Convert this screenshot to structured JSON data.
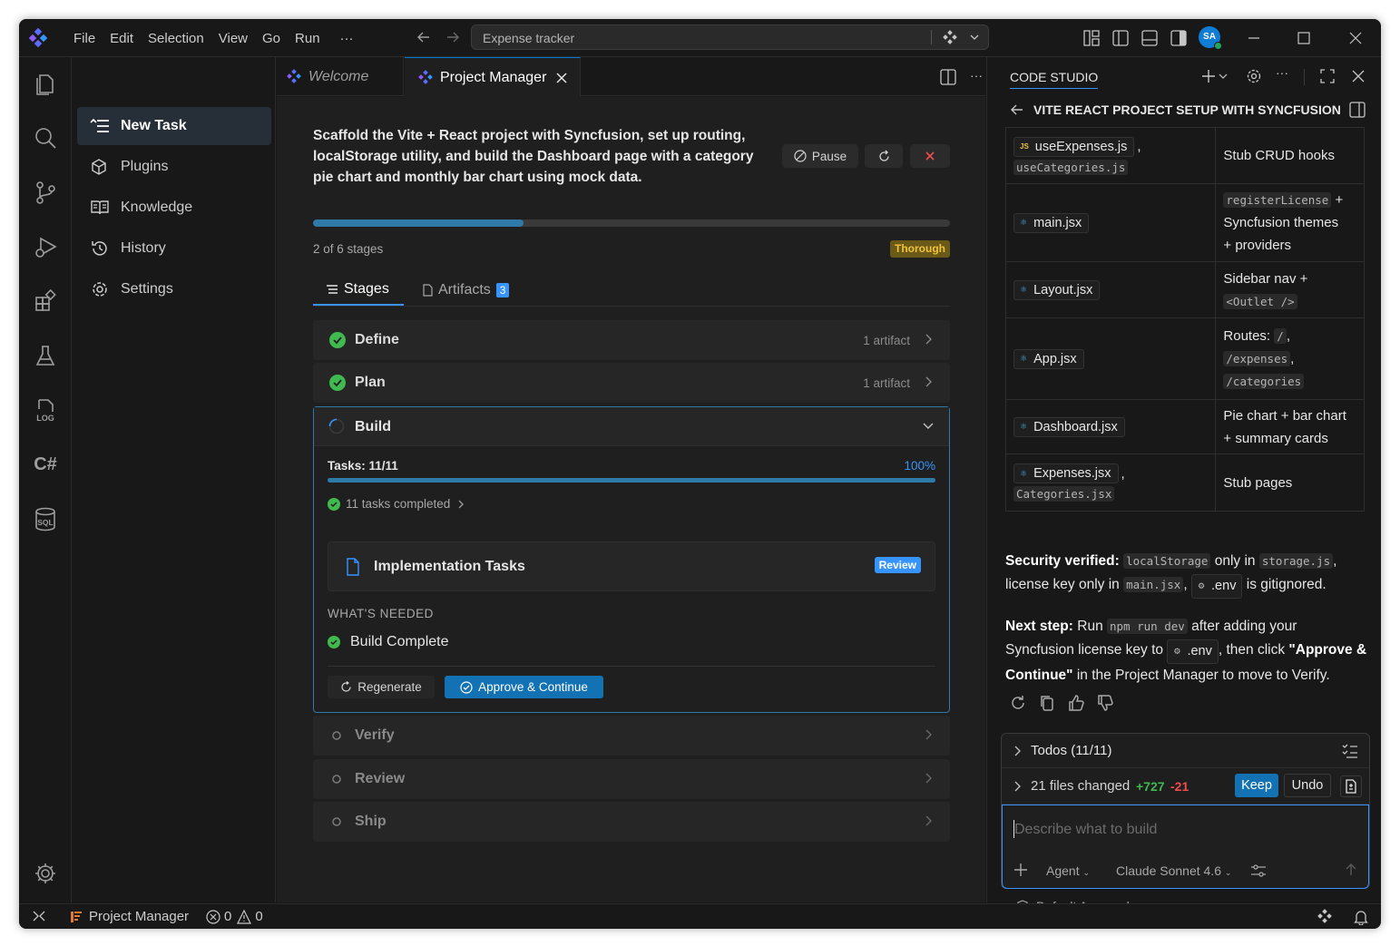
{
  "titlebar": {
    "menu": [
      "File",
      "Edit",
      "Selection",
      "View",
      "Go",
      "Run",
      "···"
    ],
    "search_text": "Expense tracker",
    "avatar_initials": "SA"
  },
  "sidebar": {
    "items": [
      {
        "label": "New Task",
        "icon": "new-task-icon",
        "active": true
      },
      {
        "label": "Plugins",
        "icon": "cube-icon"
      },
      {
        "label": "Knowledge",
        "icon": "book-icon"
      },
      {
        "label": "History",
        "icon": "history-icon"
      },
      {
        "label": "Settings",
        "icon": "settings-icon"
      }
    ]
  },
  "tabs": {
    "welcome": "Welcome",
    "project_manager": "Project Manager"
  },
  "task": {
    "description": "Scaffold the Vite + React project with Syncfusion, set up routing, localStorage utility, and build the Dashboard page with a category pie chart and monthly bar chart using mock data.",
    "pause_label": "Pause",
    "progress": 0.33,
    "stage_count": "2 of 6 stages",
    "mode_badge": "Thorough",
    "subtabs": {
      "stages": "Stages",
      "artifacts": "Artifacts",
      "artifacts_count": "3"
    }
  },
  "stages": [
    {
      "name": "Define",
      "meta": "1 artifact",
      "status": "done"
    },
    {
      "name": "Plan",
      "meta": "1 artifact",
      "status": "done"
    },
    {
      "name": "Build",
      "meta": "",
      "status": "running"
    },
    {
      "name": "Verify",
      "meta": "",
      "status": "pending"
    },
    {
      "name": "Review",
      "meta": "",
      "status": "pending"
    },
    {
      "name": "Ship",
      "meta": "",
      "status": "pending"
    }
  ],
  "build": {
    "tasks_label": "Tasks: 11/11",
    "tasks_percent": "100%",
    "tasks_progress": 1.0,
    "tasks_completed": "11 tasks completed",
    "card_title": "Implementation Tasks",
    "card_badge": "Review",
    "needed_heading": "WHAT'S NEEDED",
    "needed_item": "Build Complete",
    "regenerate": "Regenerate",
    "approve": "Approve & Continue"
  },
  "panel": {
    "title": "CODE STUDIO",
    "session": "VITE REACT PROJECT SETUP WITH SYNCFUSION",
    "table": [
      {
        "files": [
          "useExpenses.js",
          "useCategories.js"
        ],
        "desc": "Stub CRUD hooks"
      },
      {
        "files": [
          "main.jsx"
        ],
        "desc": [
          "registerLicense",
          "+",
          "Syncfusion themes",
          "+ providers"
        ]
      },
      {
        "files": [
          "Layout.jsx"
        ],
        "desc": [
          "Sidebar nav +",
          "<Outlet />"
        ]
      },
      {
        "files": [
          "App.jsx"
        ],
        "desc": [
          "Routes:",
          "/",
          ",",
          "/expenses",
          ",",
          "/categories"
        ]
      },
      {
        "files": [
          "Dashboard.jsx"
        ],
        "desc": "Pie chart + bar chart + summary cards"
      },
      {
        "files": [
          "Expenses.jsx",
          "Categories.jsx"
        ],
        "desc": "Stub pages"
      }
    ],
    "security": {
      "heading": "Security verified:",
      "code1": "localStorage",
      "t1": "only in",
      "code2": "storage.js",
      "t2": ",",
      "t3": "license key only in",
      "code3": "main.jsx",
      "t4": ",",
      "env": ".env",
      "t5": "is gitignored."
    },
    "next": {
      "heading": "Next step:",
      "t1": "Run",
      "code1": "npm run dev",
      "t2": "after adding your Syncfusion license key to",
      "env": ".env",
      "t3": ", then click",
      "bold": "\"Approve & Continue\"",
      "t4": "in the Project Manager to move to Verify."
    },
    "todos": "Todos (11/11)",
    "files_changed": "21 files changed",
    "added": "+727",
    "removed": "-21",
    "keep": "Keep",
    "undo": "Undo",
    "placeholder": "Describe what to build",
    "agent": "Agent",
    "model": "Claude Sonnet 4.6",
    "approvals": "Default Approvals"
  },
  "statusbar": {
    "project": "Project Manager",
    "errors": "0",
    "warnings": "0"
  },
  "colors": {
    "accent": "#3794ff",
    "success": "#3fb950",
    "warning_badge": "#f0c23c"
  }
}
